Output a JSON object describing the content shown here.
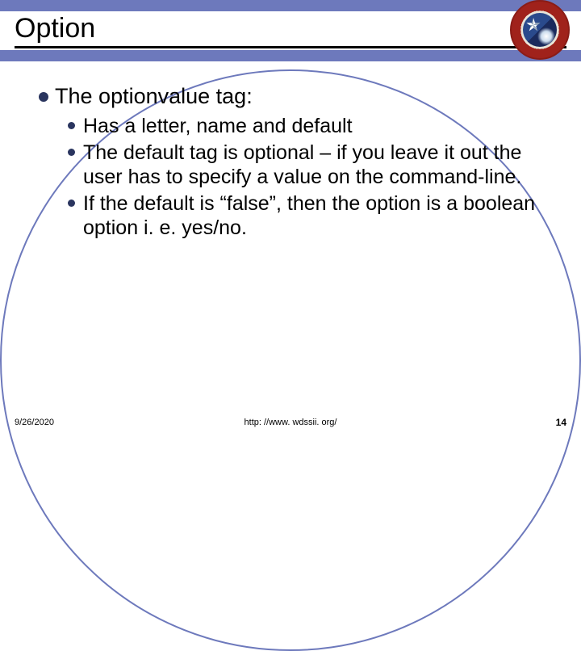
{
  "title": "Option",
  "main": {
    "heading_prefix": "The",
    "heading_rest": "optionvalue tag:",
    "bullets": [
      "Has a letter, name and default",
      "The default tag is optional – if you leave it out the user has to specify a value on the command-line.",
      "If the default is “false”, then the option is a boolean option i. e. yes/no."
    ]
  },
  "footer": {
    "date": "9/26/2020",
    "url": "http: //www. wdssii. org/",
    "page": "14"
  }
}
